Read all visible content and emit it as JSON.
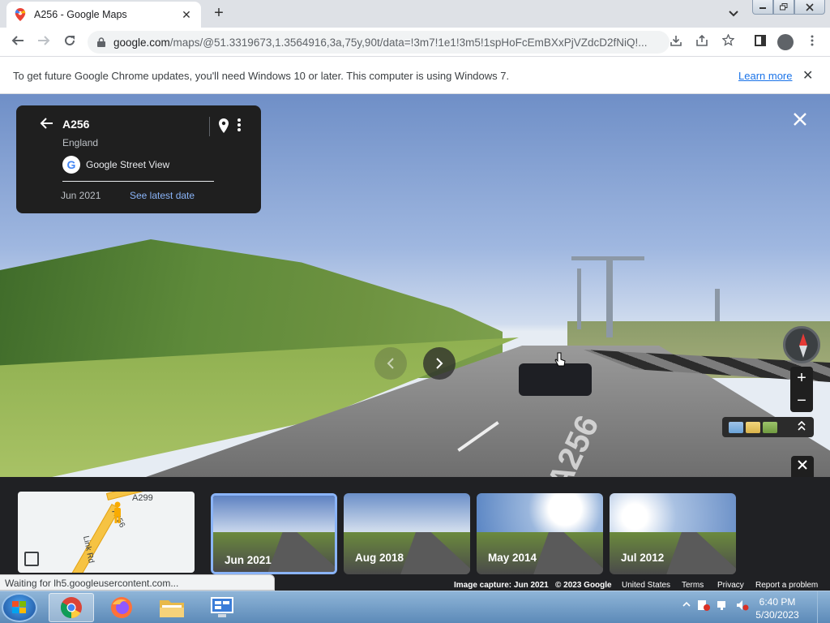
{
  "browser": {
    "tab_title": "A256 - Google Maps",
    "tab_close": "✕",
    "new_tab": "+",
    "url_host": "google.com",
    "url_path": "/maps/@51.3319673,1.3564916,3a,75y,90t/data=!3m7!1e1!3m5!1spHoFcEmBXxPjVZdcD2fNiQ!...",
    "icons": [
      "back-arrow-icon",
      "forward-arrow-icon",
      "reload-icon",
      "lock-icon",
      "install-icon",
      "share-icon",
      "star-icon",
      "side-panel-icon",
      "profile-icon",
      "kebab-menu-icon"
    ]
  },
  "infobar": {
    "message": "To get future Google Chrome updates, you'll need Windows 10 or later. This computer is using Windows 7.",
    "link": "Learn more",
    "close": "✕"
  },
  "streetview": {
    "place": "A256",
    "region": "England",
    "source": "Google Street View",
    "date": "Jun 2021",
    "latest_link": "See latest date",
    "road_marking": "A256"
  },
  "timeline": {
    "thumbnails": [
      {
        "label": "Jun 2021",
        "selected": true
      },
      {
        "label": "Aug 2018",
        "selected": false
      },
      {
        "label": "May 2014",
        "selected": false
      },
      {
        "label": "Jul 2012",
        "selected": false
      }
    ]
  },
  "minimap": {
    "road_a299": "A299",
    "road_a256": "A256",
    "road_link": "Link Rd"
  },
  "footer": {
    "capture": "Image capture: Jun 2021",
    "copyright": "© 2023 Google",
    "country": "United States",
    "terms": "Terms",
    "privacy": "Privacy",
    "report": "Report a problem"
  },
  "status_text": "Waiting for lh5.googleusercontent.com...",
  "taskbar": {
    "time": "6:40 PM",
    "date": "5/30/2023"
  },
  "colors": {
    "accent_blue": "#8ab4f8",
    "card_bg": "#1f1f1f",
    "road_yellow": "#f6c343"
  }
}
